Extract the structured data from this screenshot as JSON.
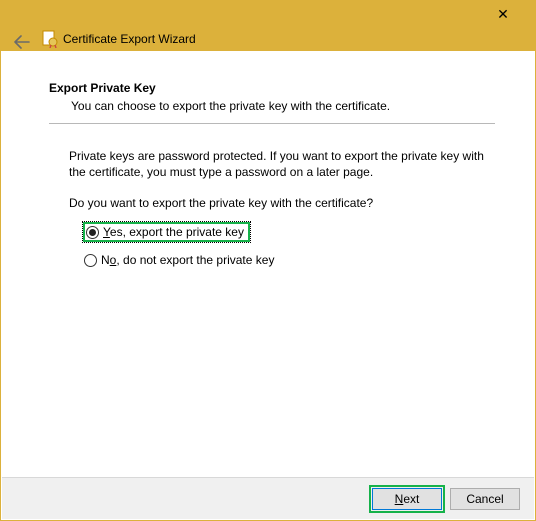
{
  "title": "Certificate Export Wizard",
  "heading": "Export Private Key",
  "sub": "You can choose to export the private key with the certificate.",
  "body": "Private keys are password protected. If you want to export the private key with the certificate, you must type a password on a later page.",
  "question": "Do you want to export the private key with the certificate?",
  "options": {
    "yes_accel": "Y",
    "yes_rest": "es, export the private key",
    "no_pre": "N",
    "no_accel": "o",
    "no_rest": ", do not export the private key"
  },
  "buttons": {
    "next": "Next",
    "cancel": "Cancel"
  }
}
